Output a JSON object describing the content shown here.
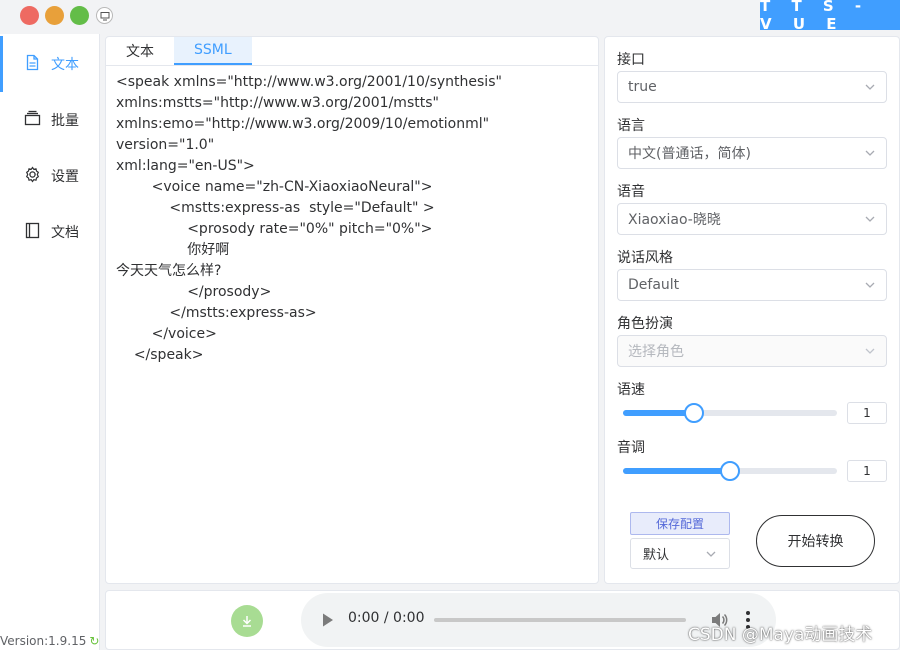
{
  "window": {
    "brand": "T T S - V U E",
    "controls": [
      "close",
      "minimize",
      "maximize"
    ],
    "screen_icon": "screen-icon"
  },
  "sidebar": {
    "items": [
      {
        "label": "文本",
        "icon": "document-icon",
        "active": true
      },
      {
        "label": "批量",
        "icon": "layers-icon",
        "active": false
      },
      {
        "label": "设置",
        "icon": "gear-icon",
        "active": false
      },
      {
        "label": "文档",
        "icon": "book-icon",
        "active": false
      }
    ],
    "version": "Version:1.9.15"
  },
  "editor": {
    "tabs": [
      {
        "label": "文本",
        "active": false
      },
      {
        "label": "SSML",
        "active": true
      }
    ],
    "content": "<speak xmlns=\"http://www.w3.org/2001/10/synthesis\"\nxmlns:mstts=\"http://www.w3.org/2001/mstts\"\nxmlns:emo=\"http://www.w3.org/2009/10/emotionml\" version=\"1.0\"\nxml:lang=\"en-US\">\n        <voice name=\"zh-CN-XiaoxiaoNeural\">\n            <mstts:express-as  style=\"Default\" >\n                <prosody rate=\"0%\" pitch=\"0%\">\n                你好啊\n今天天气怎么样?\n                </prosody>\n            </mstts:express-as>\n        </voice>\n    </speak>"
  },
  "config": {
    "api": {
      "label": "接口",
      "value": "true"
    },
    "language": {
      "label": "语言",
      "value": "中文(普通话，简体)"
    },
    "voice": {
      "label": "语音",
      "value": "Xiaoxiao-晓晓"
    },
    "style": {
      "label": "说话风格",
      "value": "Default"
    },
    "role": {
      "label": "角色扮演",
      "placeholder": "选择角色"
    },
    "rate": {
      "label": "语速",
      "value": "1",
      "level": 0.33
    },
    "pitch": {
      "label": "音调",
      "value": "1",
      "level": 0.5
    },
    "save_label": "保存配置",
    "preset": "默认",
    "start_label": "开始转换"
  },
  "player": {
    "time": "0:00 / 0:00",
    "icons": [
      "download-icon",
      "play-icon",
      "volume-icon",
      "more-icon"
    ]
  },
  "watermark": "CSDN @Maya动画技术",
  "colors": {
    "accent": "#409eff",
    "download_button": "#a8dc93",
    "save_button_text": "#5468d8"
  }
}
